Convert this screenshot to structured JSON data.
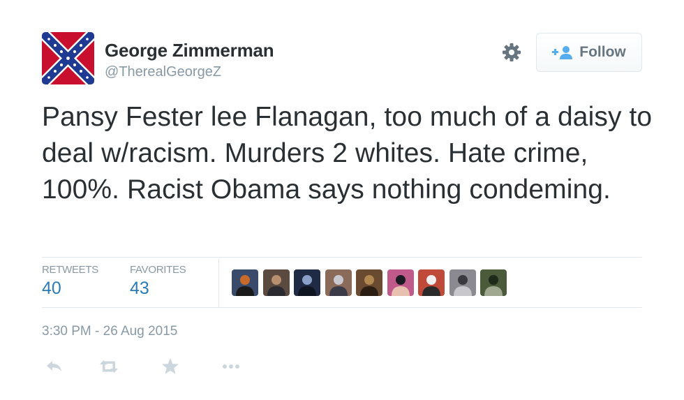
{
  "user": {
    "fullname": "George Zimmerman",
    "handle": "@TherealGeorgeZ",
    "avatar_icon": "confederate-flag-avatar"
  },
  "header": {
    "gear_icon": "gear-icon",
    "follow_icon": "add-user-icon",
    "follow_label": "Follow"
  },
  "tweet": {
    "text": "Pansy Fester lee Flanagan, too much of a daisy to deal w/racism. Murders 2 whites. Hate crime, 100%. Racist Obama says nothing condeming."
  },
  "stats": {
    "retweets_label": "RETWEETS",
    "retweets_count": "40",
    "favorites_label": "FAVORITES",
    "favorites_count": "43"
  },
  "favoriters": [
    {
      "name": "favoriter-avatar-1",
      "colors": [
        "#3a4a6a",
        "#c86a2a",
        "#1a1a1a"
      ]
    },
    {
      "name": "favoriter-avatar-2",
      "colors": [
        "#5a4a40",
        "#b89070",
        "#2a2a30"
      ]
    },
    {
      "name": "favoriter-avatar-3",
      "colors": [
        "#1f2a44",
        "#8aa0c8",
        "#0e1420"
      ]
    },
    {
      "name": "favoriter-avatar-4",
      "colors": [
        "#8a6a58",
        "#c8c8d0",
        "#3a3a48"
      ]
    },
    {
      "name": "favoriter-avatar-5",
      "colors": [
        "#6a4a30",
        "#b08850",
        "#2a1e12"
      ]
    },
    {
      "name": "favoriter-avatar-6",
      "colors": [
        "#c05a8a",
        "#1a1a22",
        "#e8c0b0"
      ]
    },
    {
      "name": "favoriter-avatar-7",
      "colors": [
        "#c04a3a",
        "#f0f0f0",
        "#2a2a2a"
      ]
    },
    {
      "name": "favoriter-avatar-8",
      "colors": [
        "#8a8a90",
        "#3a3a3e",
        "#c8c8cc"
      ]
    },
    {
      "name": "favoriter-avatar-9",
      "colors": [
        "#4a5a3a",
        "#1e2a1a",
        "#a0a890"
      ]
    }
  ],
  "timestamp": "3:30 PM - 26 Aug 2015",
  "actions": [
    {
      "name": "reply-icon"
    },
    {
      "name": "retweet-icon"
    },
    {
      "name": "favorite-icon"
    },
    {
      "name": "more-icon"
    }
  ],
  "colors": {
    "text": "#292f33",
    "muted": "#8899a6",
    "link_blue": "#2b7bb9",
    "action_gray": "#ccd6dd",
    "border": "#e1e8ed",
    "flag_red": "#c8102e",
    "flag_blue": "#1f3a93"
  }
}
